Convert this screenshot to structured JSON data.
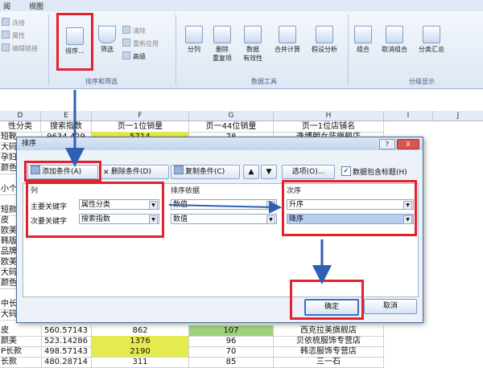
{
  "menu": {
    "tab1": "阅",
    "tab2": "视图"
  },
  "ribbon": {
    "small_left": [
      "连接",
      "属性",
      "编辑链接"
    ],
    "sort_label": "排序...",
    "filter_label": "筛选",
    "filter_small": [
      "清除",
      "重新应用",
      "高级"
    ],
    "split_label": "分列",
    "dedupe_label": "删除\n重复项",
    "validate_label": "数据\n有效性",
    "consolidate_label": "合并计算",
    "whatif_label": "假设分析",
    "group_label": "组合",
    "ungroup_label": "取消组合",
    "subtotal_label": "分类汇总",
    "group_names": [
      "排序和筛选",
      "数据工具",
      "分级显示"
    ]
  },
  "sheet": {
    "columns": [
      "D",
      "E",
      "F",
      "G",
      "H",
      "I",
      "J"
    ],
    "header_row": [
      "性分类",
      "搜索指数",
      "页一1位销量",
      "页一44位销量",
      "页一1位店铺名"
    ],
    "top_row": [
      "短靴",
      "9634.429",
      "5714",
      "78",
      "逸博朗女装旗舰店"
    ],
    "left_cells": [
      "大码",
      "孕妇",
      "颜色",
      "小个",
      "短款",
      "皮",
      "欧美",
      "韩版",
      "品牌",
      "欧美",
      "大码",
      "颜色",
      "中长",
      "大码"
    ],
    "bottom_rows": [
      [
        "皮",
        "560.57143",
        "862",
        "107",
        "西克拉美旗舰店"
      ],
      [
        "颜美",
        "523.14286",
        "1376",
        "96",
        "贝依梳服饰专营店"
      ],
      [
        "P长款",
        "498.57143",
        "2190",
        "70",
        "韩恣服饰专营店"
      ],
      [
        "长款",
        "480.28714",
        "311",
        "85",
        "三一石"
      ]
    ]
  },
  "dialog": {
    "title": "排序",
    "help": "?",
    "close": "X",
    "add_level": "添加条件(A)",
    "delete_level": "删除条件(D)",
    "copy_level": "复制条件(C)",
    "options": "选项(O)...",
    "has_header": "数据包含标题(H)",
    "col_header": "列",
    "sort_on_header": "排序依据",
    "order_header": "次序",
    "primary_key": "主要关键字",
    "secondary_key": "次要关键字",
    "primary_col": "属性分类",
    "secondary_col": "搜索指数",
    "primary_on": "数值",
    "secondary_on": "数值",
    "primary_order": "升序",
    "secondary_order": "降序",
    "ok": "确定",
    "cancel": "取消"
  },
  "colors": {
    "annotation_red": "#e0232f",
    "arrow_blue": "#2f5fb0",
    "row_yellow": "#e4ea4f",
    "row_green": "#9fd07a"
  }
}
